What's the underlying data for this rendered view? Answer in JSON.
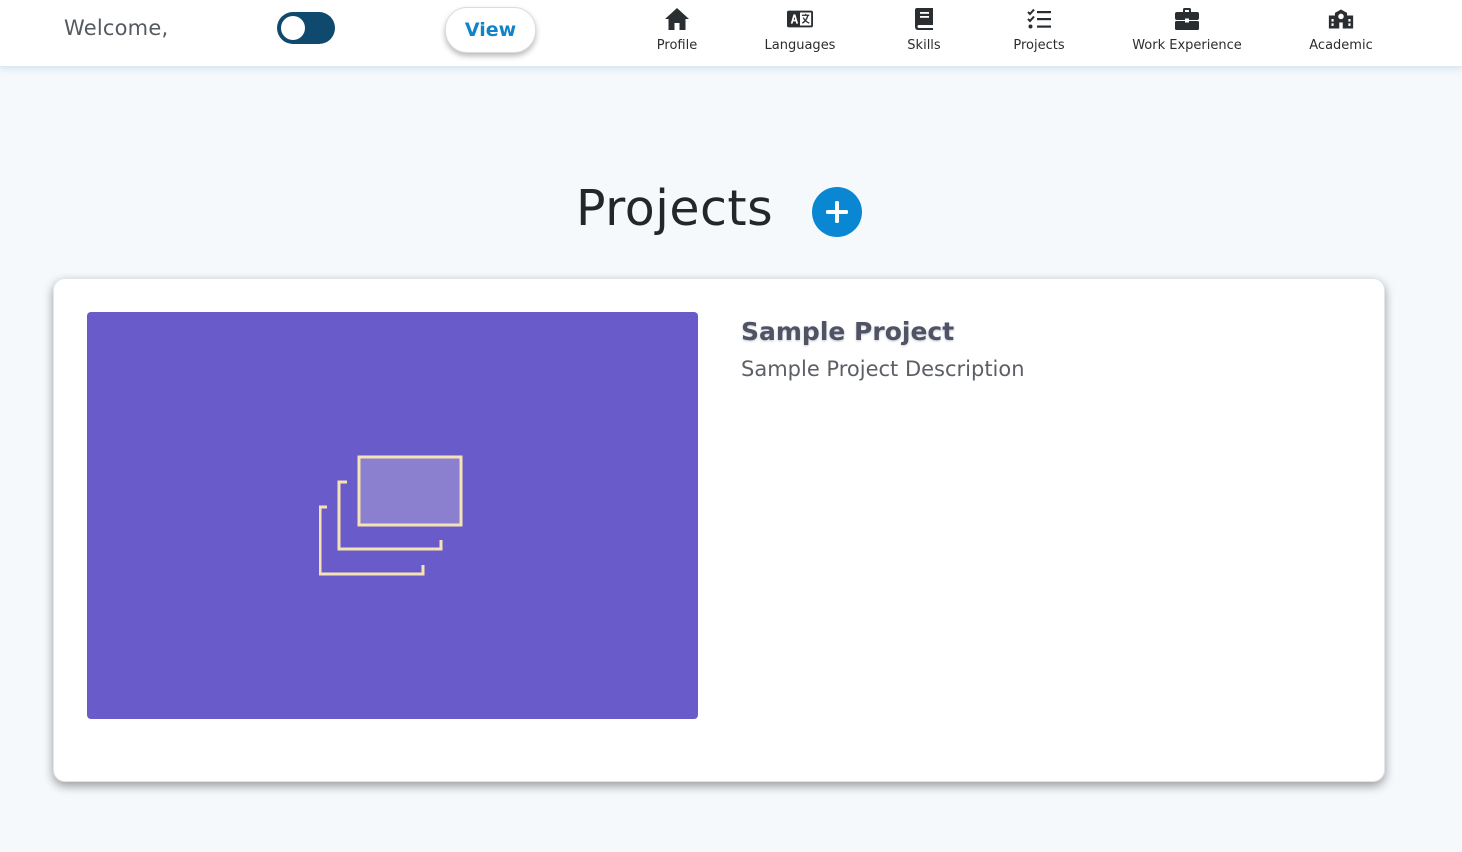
{
  "header": {
    "welcome_text": "Welcome,",
    "toggle": {
      "state": "on",
      "color": "#0f4a6e"
    },
    "view_label": "View",
    "nav": [
      {
        "label": "Profile",
        "icon": "home-icon"
      },
      {
        "label": "Languages",
        "icon": "language-icon"
      },
      {
        "label": "Skills",
        "icon": "book-icon"
      },
      {
        "label": "Projects",
        "icon": "list-check-icon"
      },
      {
        "label": "Work Experience",
        "icon": "briefcase-icon"
      },
      {
        "label": "Academic",
        "icon": "school-icon"
      }
    ]
  },
  "main": {
    "title": "Projects",
    "add_button_icon": "plus-icon",
    "accent_color": "#0a87d3",
    "projects": [
      {
        "title": "Sample Project",
        "description": "Sample Project Description",
        "image_icon": "images-placeholder-icon",
        "image_bg": "#6a5bca"
      }
    ]
  }
}
